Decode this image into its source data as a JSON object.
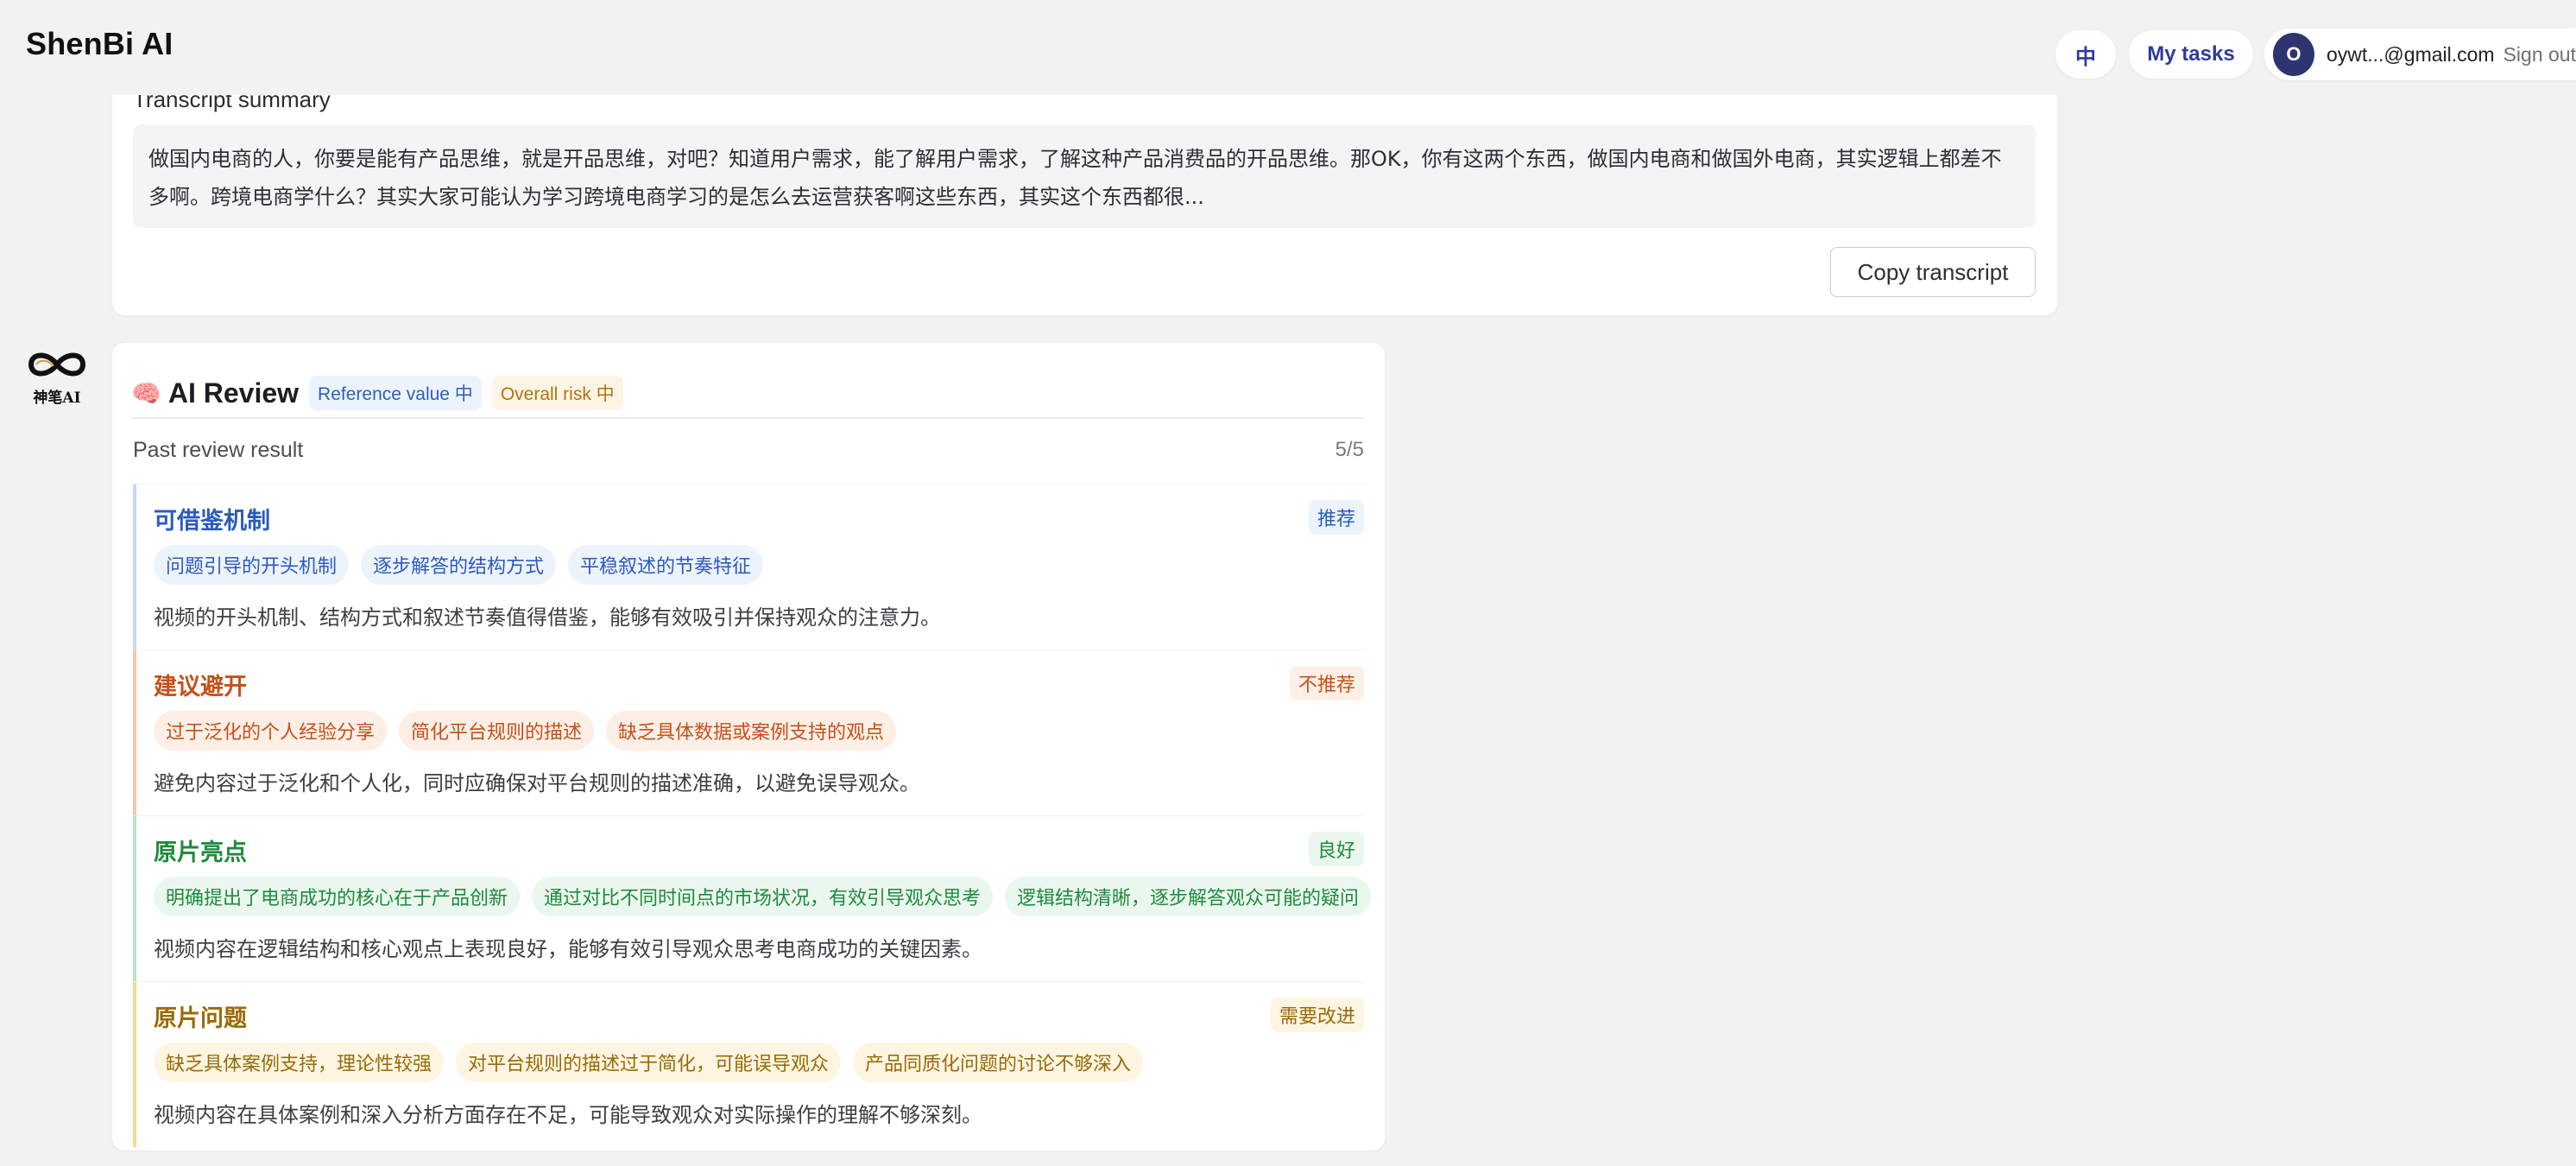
{
  "app": {
    "name": "ShenBi AI"
  },
  "header": {
    "lang_label": "中",
    "tasks_label": "My tasks",
    "user": {
      "avatar_initial": "O",
      "email": "oywt...@gmail.com",
      "signout_label": "Sign out"
    }
  },
  "transcript": {
    "title": "Transcript summary",
    "text": "做国内电商的人，你要是能有产品思维，就是开品思维，对吧？知道用户需求，能了解用户需求，了解这种产品消费品的开品思维。那OK，你有这两个东西，做国内电商和做国外电商，其实逻辑上都差不多啊。跨境电商学什么？其实大家可能认为学习跨境电商学习的是怎么去运营获客啊这些东西，其实这个东西都很...",
    "copy_label": "Copy transcript"
  },
  "logo": {
    "label": "神笔AI"
  },
  "review": {
    "icon": "brain-icon",
    "title": "AI Review",
    "reference_badge": "Reference value 中",
    "risk_badge": "Overall risk 中",
    "past_label": "Past review result",
    "past_count": "5/5",
    "sections": [
      {
        "title": "可借鉴机制",
        "tag": "推荐",
        "chips": [
          "问题引导的开头机制",
          "逐步解答的结构方式",
          "平稳叙述的节奏特征"
        ],
        "desc": "视频的开头机制、结构方式和叙述节奏值得借鉴，能够有效吸引并保持观众的注意力。"
      },
      {
        "title": "建议避开",
        "tag": "不推荐",
        "chips": [
          "过于泛化的个人经验分享",
          "简化平台规则的描述",
          "缺乏具体数据或案例支持的观点"
        ],
        "desc": "避免内容过于泛化和个人化，同时应确保对平台规则的描述准确，以避免误导观众。"
      },
      {
        "title": "原片亮点",
        "tag": "良好",
        "chips": [
          "明确提出了电商成功的核心在于产品创新",
          "通过对比不同时间点的市场状况，有效引导观众思考",
          "逻辑结构清晰，逐步解答观众可能的疑问"
        ],
        "desc": "视频内容在逻辑结构和核心观点上表现良好，能够有效引导观众思考电商成功的关键因素。"
      },
      {
        "title": "原片问题",
        "tag": "需要改进",
        "chips": [
          "缺乏具体案例支持，理论性较强",
          "对平台规则的描述过于简化，可能误导观众",
          "产品同质化问题的讨论不够深入"
        ],
        "desc": "视频内容在具体案例和深入分析方面存在不足，可能导致观众对实际操作的理解不够深刻。"
      }
    ]
  },
  "colors": {
    "accent_blue": "#2b5bbd",
    "accent_orange": "#c4501a",
    "accent_green": "#1f8a3c",
    "accent_yellow": "#9a6a06",
    "background": "#f2f2f3"
  }
}
